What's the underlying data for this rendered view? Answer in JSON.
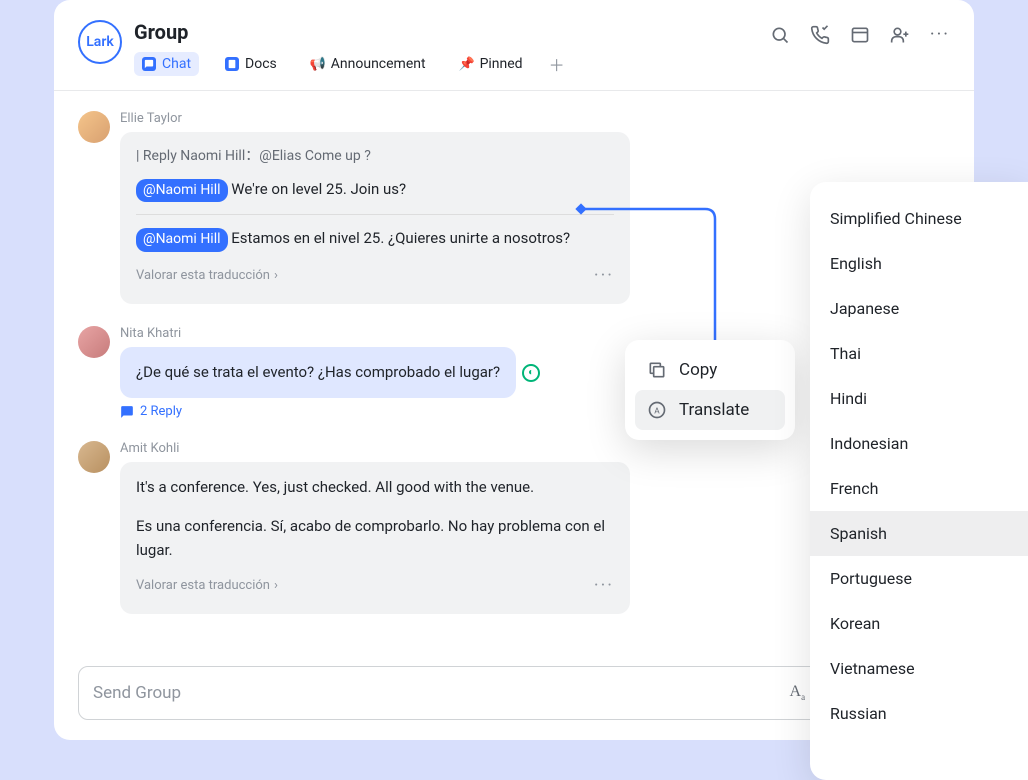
{
  "logo": "Lark",
  "title": "Group",
  "tabs": {
    "chat": "Chat",
    "docs": "Docs",
    "announcement": "Announcement",
    "pinned": "Pinned"
  },
  "messages": [
    {
      "sender": "Ellie Taylor",
      "reply_ref": "| Reply Naomi Hill：@Elias Come up ?",
      "mention": "@Naomi Hill",
      "text_original": "We're on level 25. Join us?",
      "text_translated": "Estamos en el nivel 25. ¿Quieres unirte a nosotros?",
      "rate_text": "Valorar esta traducción"
    },
    {
      "sender": "Nita Khatri",
      "text_blue": "¿De qué se trata el evento? ¿Has comprobado el lugar?",
      "reply_count": "2 Reply"
    },
    {
      "sender": "Amit Kohli",
      "text_original": "It's a conference. Yes, just checked. All good with the venue.",
      "text_translated": "Es una conferencia. Sí, acabo de comprobarlo. No hay problema con el lugar.",
      "rate_text": "Valorar esta traducción"
    }
  ],
  "context_menu": {
    "copy": "Copy",
    "translate": "Translate"
  },
  "languages": [
    "Simplified Chinese",
    "English",
    "Japanese",
    "Thai",
    "Hindi",
    "Indonesian",
    "French",
    "Spanish",
    "Portuguese",
    "Korean",
    "Vietnamese",
    "Russian"
  ],
  "selected_language": "Spanish",
  "composer_placeholder": "Send Group"
}
